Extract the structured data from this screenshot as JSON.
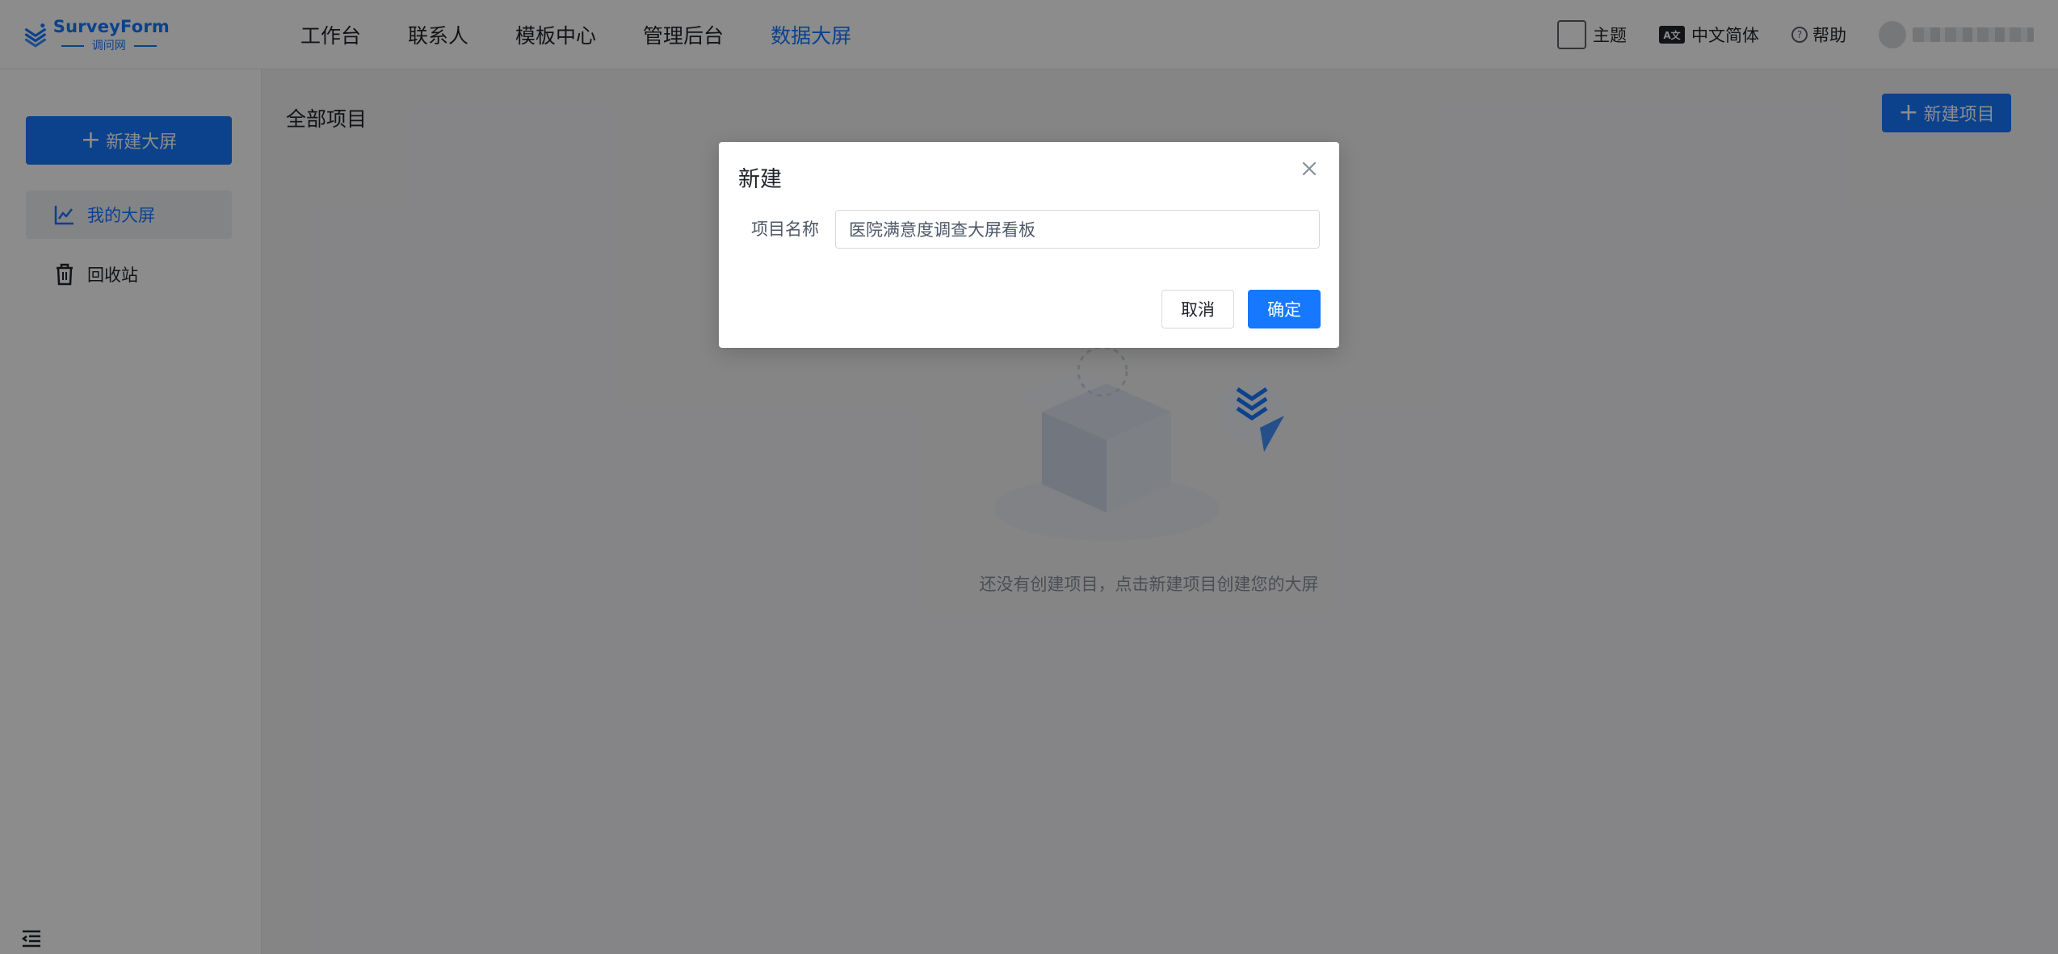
{
  "app": {
    "logo_title": "SurveyForm",
    "logo_sub": "调问网"
  },
  "nav": {
    "items": [
      {
        "label": "工作台"
      },
      {
        "label": "联系人"
      },
      {
        "label": "模板中心"
      },
      {
        "label": "管理后台"
      },
      {
        "label": "数据大屏"
      }
    ],
    "active_index": 4
  },
  "top_right": {
    "theme_label": "主题",
    "lang_badge": "A文",
    "lang_label": "中文简体",
    "help_label": "帮助"
  },
  "sidebar": {
    "new_button_label": "新建大屏",
    "items": [
      {
        "label": "我的大屏",
        "icon": "line-chart-icon",
        "active": true
      },
      {
        "label": "回收站",
        "icon": "trash-icon",
        "active": false
      }
    ]
  },
  "main": {
    "title": "全部项目",
    "new_project_label": "新建项目",
    "empty_text": "还没有创建项目，点击新建项目创建您的大屏"
  },
  "modal": {
    "title": "新建",
    "field_label": "项目名称",
    "field_value": "医院满意度调查大屏看板",
    "cancel_label": "取消",
    "ok_label": "确定"
  },
  "colors": {
    "primary": "#1677ff",
    "mask": "rgba(0,0,0,0.45)"
  }
}
